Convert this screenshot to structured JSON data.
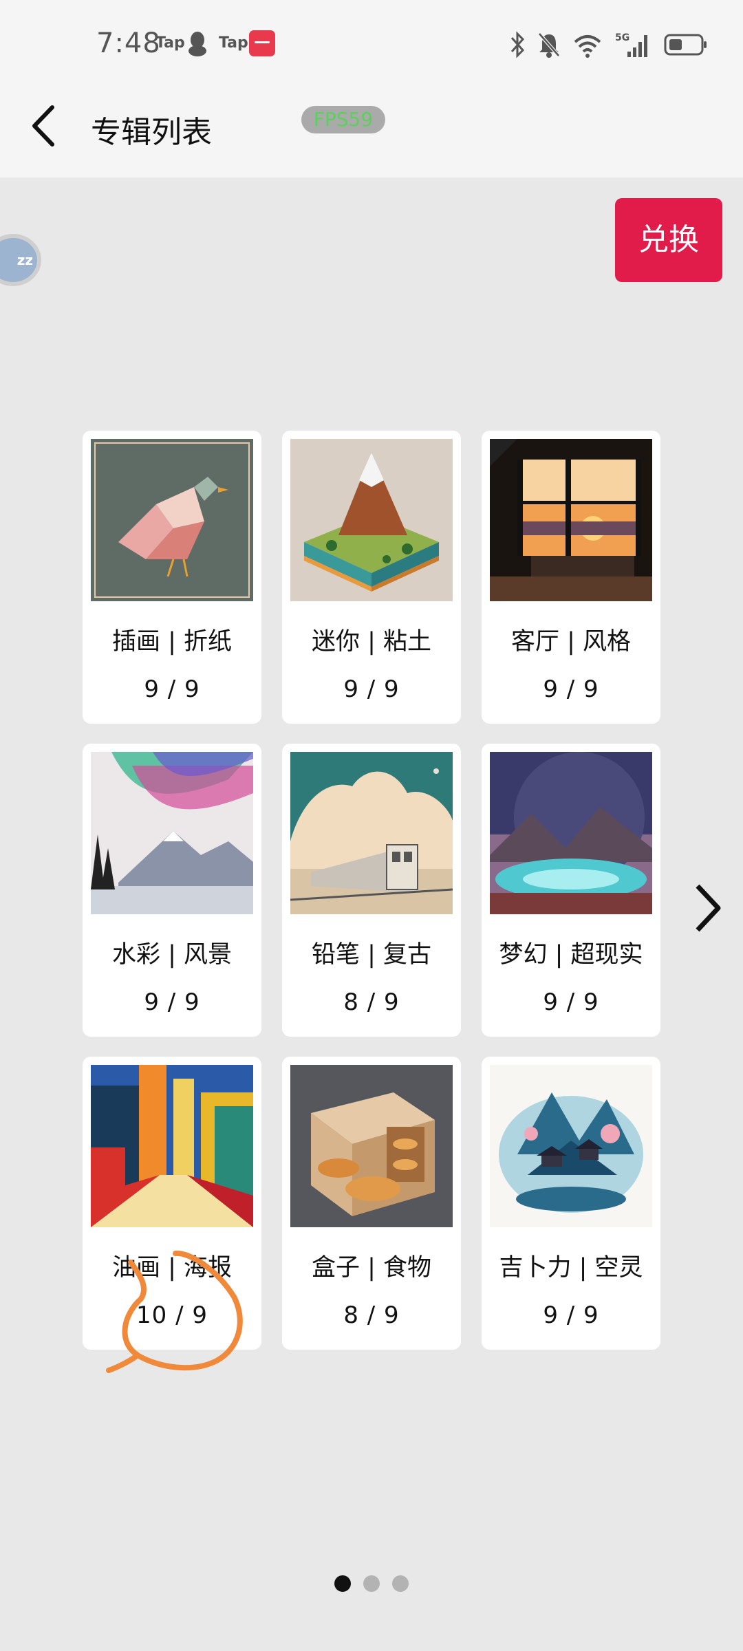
{
  "status_bar": {
    "time": "7:48",
    "apps": [
      "Tap",
      "Tap"
    ],
    "icons": [
      "bluetooth-icon",
      "bell-muted-icon",
      "wifi-icon",
      "signal-5g-icon",
      "battery-icon"
    ],
    "network": "5G"
  },
  "header": {
    "title": "专辑列表",
    "fps": "FPS59"
  },
  "floating_bubble": {
    "label": "zz"
  },
  "redeem_button": {
    "label": "兑换"
  },
  "albums": [
    {
      "title": "插画 | 折纸",
      "progress": "9 / 9"
    },
    {
      "title": "迷你 | 粘土",
      "progress": "9 / 9"
    },
    {
      "title": "客厅 | 风格",
      "progress": "9 / 9"
    },
    {
      "title": "水彩 | 风景",
      "progress": "9 / 9"
    },
    {
      "title": "铅笔 | 复古",
      "progress": "8 / 9"
    },
    {
      "title": "梦幻 | 超现实",
      "progress": "9 / 9"
    },
    {
      "title": "油画 | 海报",
      "progress": "10 / 9"
    },
    {
      "title": "盒子 | 食物",
      "progress": "8 / 9"
    },
    {
      "title": "吉卜力 | 空灵",
      "progress": "9 / 9"
    }
  ],
  "pagination": {
    "pages": 3,
    "current": 1
  },
  "colors": {
    "accent": "#e21c4a",
    "fps_text": "#5cd05c",
    "annotation": "#f08a3a"
  }
}
